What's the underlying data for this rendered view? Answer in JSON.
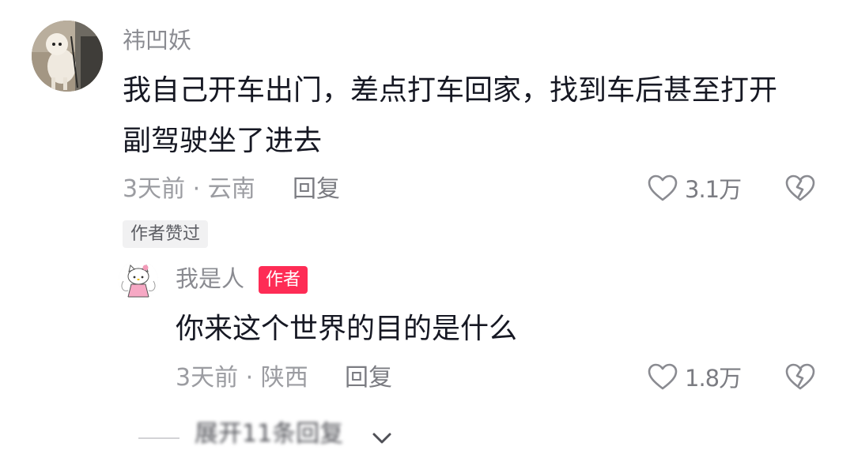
{
  "comment": {
    "username": "祎凹妖",
    "text_line1": "我自己开车出门，差点打车回家，找到车后甚至打开",
    "text_line2": "副驾驶坐了进去",
    "time_location": "3天前 · 云南",
    "reply_label": "回复",
    "like_count": "3.1万",
    "liked_by_author_label": "作者赞过"
  },
  "reply": {
    "username": "我是人",
    "author_badge": "作者",
    "text": "你来这个世界的目的是什么",
    "time_location": "3天前 · 陕西",
    "reply_label": "回复",
    "like_count": "1.8万"
  },
  "expand": {
    "label": "展开11条回复"
  },
  "icons": {
    "like": "heart-outline-icon",
    "dislike": "broken-heart-icon",
    "expand": "chevron-down-icon"
  },
  "colors": {
    "author_badge": "#fe2c55",
    "liked_badge_bg": "#f1f1f2",
    "primary_text": "#161823",
    "secondary_text": "#8a8b91"
  }
}
